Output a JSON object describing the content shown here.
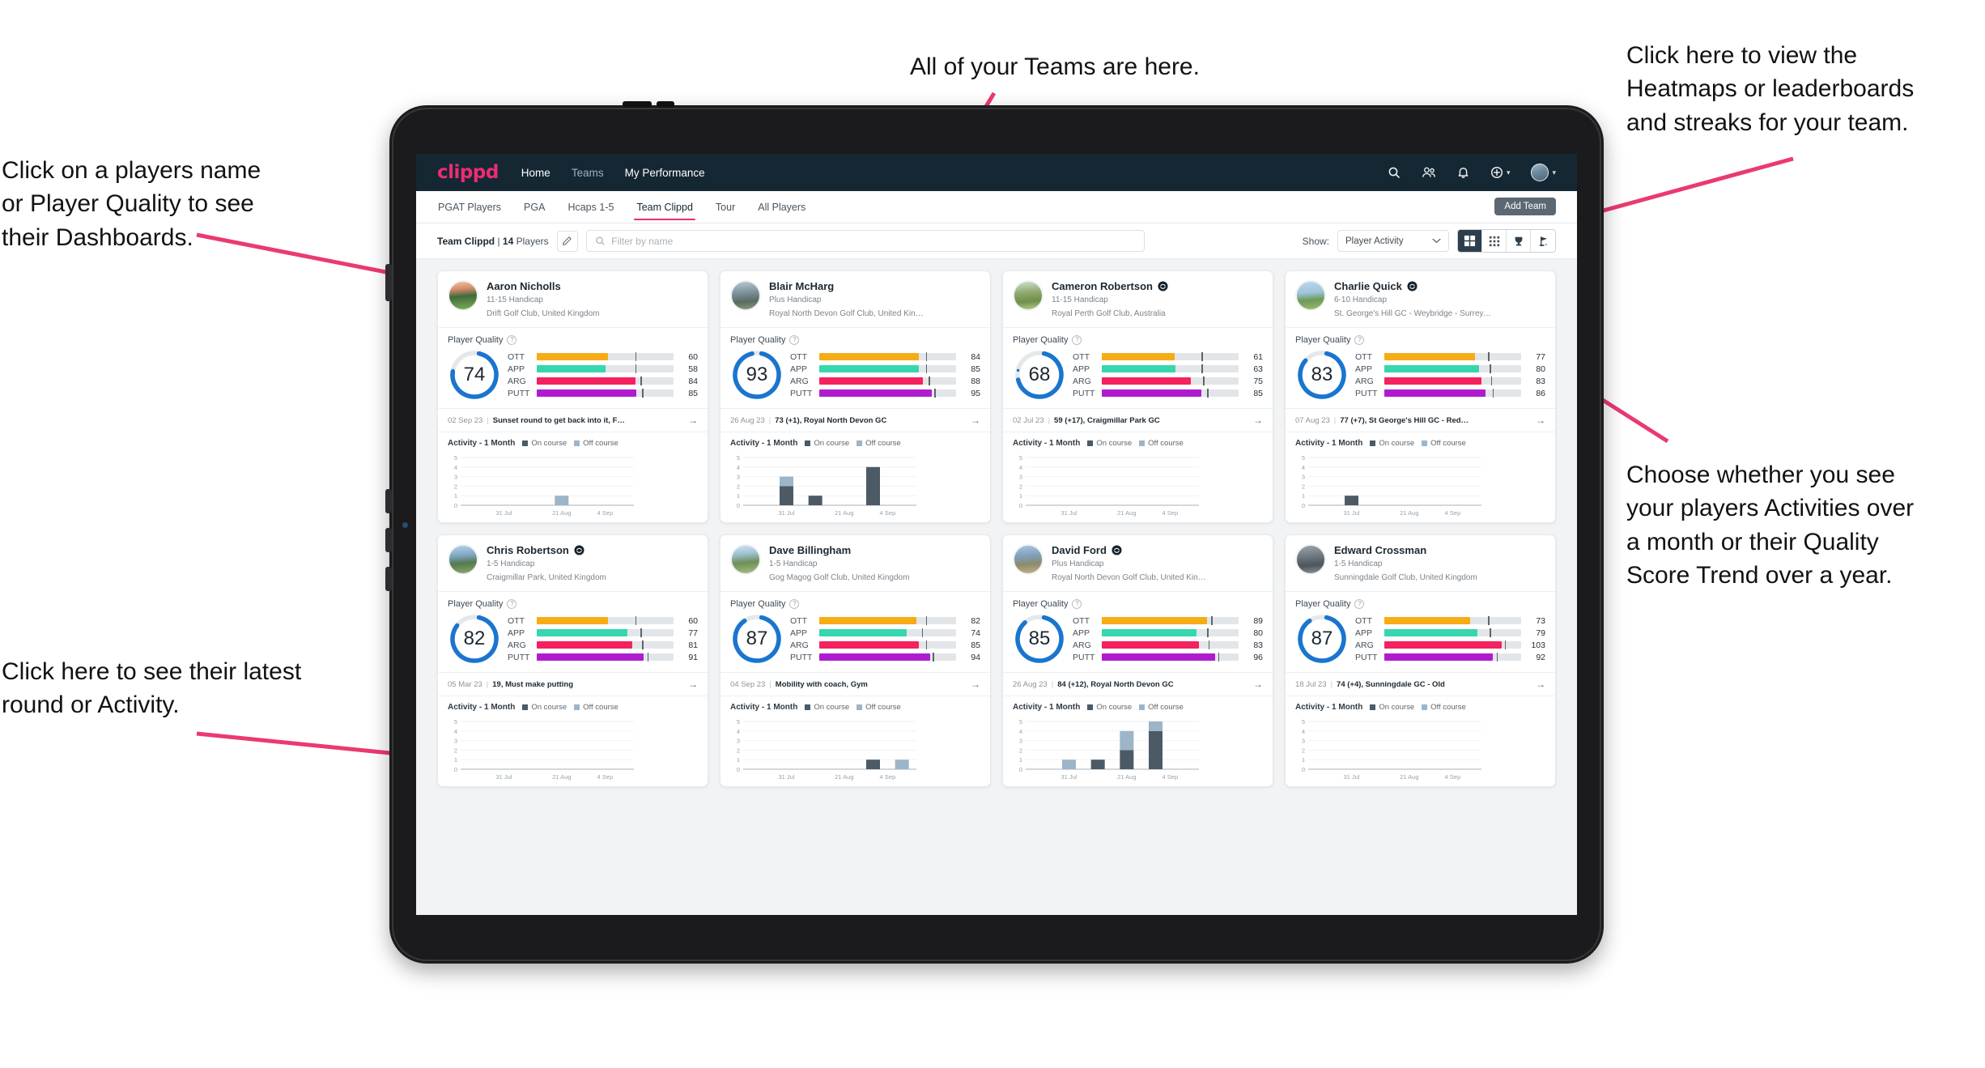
{
  "annotations": {
    "top": "All of your Teams are here.",
    "left_top": "Click on a players name\nor Player Quality to see\ntheir Dashboards.",
    "left_bottom": "Click here to see their latest\nround or Activity.",
    "right_top": "Click here to view the\nHeatmaps or leaderboards\nand streaks for your team.",
    "right_bottom": "Choose whether you see\nyour players Activities over\na month or their Quality\nScore Trend over a year.",
    "arrow_color": "#ea3a70"
  },
  "app": {
    "brand": "clippd",
    "nav": [
      {
        "label": "Home",
        "active": true
      },
      {
        "label": "Teams",
        "active": false
      },
      {
        "label": "My Performance",
        "active": false
      }
    ],
    "nav_icons": [
      {
        "name": "search-icon"
      },
      {
        "name": "people-icon"
      },
      {
        "name": "bell-icon"
      },
      {
        "name": "plus-circle-icon"
      },
      {
        "name": "avatar"
      }
    ],
    "tabs": [
      {
        "label": "PGAT Players",
        "active": false
      },
      {
        "label": "PGA",
        "active": false
      },
      {
        "label": "Hcaps 1-5",
        "active": false
      },
      {
        "label": "Team Clippd",
        "active": true
      },
      {
        "label": "Tour",
        "active": false
      },
      {
        "label": "All Players",
        "active": false
      }
    ],
    "add_team_label": "Add Team",
    "filter": {
      "team_name": "Team Clippd",
      "team_separator": " | ",
      "player_count": "14",
      "players_word": " Players",
      "edit_icon": "pencil-icon",
      "search_placeholder": "Filter by name",
      "search_value": "",
      "show_label": "Show:",
      "show_value": "Player Activity",
      "view_modes": [
        {
          "name": "grid-large-view",
          "active": true
        },
        {
          "name": "grid-small-view",
          "active": false
        },
        {
          "name": "trophy-leaderboard-view",
          "active": false
        },
        {
          "name": "flag-heatmap-view",
          "active": false
        }
      ]
    },
    "card_labels": {
      "player_quality": "Player Quality",
      "activity": "Activity - 1 Month",
      "legend_on": "On course",
      "legend_off": "Off course"
    },
    "metric_colors": {
      "OTT": "#f6ac14",
      "APP": "#36d6ae",
      "ARG": "#f4225f",
      "PUTT": "#af1ccf",
      "ring": "#1a75cf",
      "track": "#e3e6e9"
    },
    "chart_axis": {
      "y_ticks": [
        "5",
        "4",
        "3",
        "2",
        "1",
        "0"
      ],
      "x_ticks": [
        "31 Jul",
        "21 Aug",
        "4 Sep"
      ]
    }
  },
  "players": [
    {
      "name": "Aaron Nicholls",
      "verified": false,
      "handicap": "11-15 Handicap",
      "club": "Drift Golf Club, United Kingdom",
      "quality": "74",
      "ring_pct": 74,
      "metrics": [
        {
          "label": "OTT",
          "value": "60",
          "fill": 52,
          "tick": 72
        },
        {
          "label": "APP",
          "value": "58",
          "fill": 50,
          "tick": 72
        },
        {
          "label": "ARG",
          "value": "84",
          "fill": 72,
          "tick": 76
        },
        {
          "label": "PUTT",
          "value": "85",
          "fill": 73,
          "tick": 77
        }
      ],
      "latest_date": "02 Sep 23",
      "latest_text": "Sunset round to get back into it, F…",
      "chart_data": {
        "type": "bar",
        "title": "Activity - 1 Month",
        "series": [
          {
            "name": "On course",
            "values": [
              0,
              0,
              0,
              0,
              0,
              0
            ]
          },
          {
            "name": "Off course",
            "values": [
              0,
              0,
              0,
              1,
              0,
              0
            ]
          }
        ],
        "ylim": [
          0,
          5
        ]
      }
    },
    {
      "name": "Blair McHarg",
      "verified": false,
      "handicap": "Plus Handicap",
      "club": "Royal North Devon Golf Club, United Kin…",
      "quality": "93",
      "ring_pct": 93,
      "metrics": [
        {
          "label": "OTT",
          "value": "84",
          "fill": 73,
          "tick": 78
        },
        {
          "label": "APP",
          "value": "85",
          "fill": 73,
          "tick": 78
        },
        {
          "label": "ARG",
          "value": "88",
          "fill": 76,
          "tick": 80
        },
        {
          "label": "PUTT",
          "value": "95",
          "fill": 82,
          "tick": 84
        }
      ],
      "latest_date": "26 Aug 23",
      "latest_text": "73 (+1), Royal North Devon GC",
      "chart_data": {
        "type": "bar",
        "title": "Activity - 1 Month",
        "series": [
          {
            "name": "On course",
            "values": [
              0,
              2,
              1,
              0,
              4,
              0
            ]
          },
          {
            "name": "Off course",
            "values": [
              0,
              1,
              0,
              0,
              0,
              0
            ]
          }
        ],
        "ylim": [
          0,
          5
        ]
      }
    },
    {
      "name": "Cameron Robertson",
      "verified": true,
      "handicap": "11-15 Handicap",
      "club": "Royal Perth Golf Club, Australia",
      "quality": "68",
      "ring_pct": 68,
      "metrics": [
        {
          "label": "OTT",
          "value": "61",
          "fill": 53,
          "tick": 73
        },
        {
          "label": "APP",
          "value": "63",
          "fill": 54,
          "tick": 73
        },
        {
          "label": "ARG",
          "value": "75",
          "fill": 65,
          "tick": 74
        },
        {
          "label": "PUTT",
          "value": "85",
          "fill": 73,
          "tick": 77
        }
      ],
      "latest_date": "02 Jul 23",
      "latest_text": "59 (+17), Craigmillar Park GC",
      "chart_data": {
        "type": "bar",
        "title": "Activity - 1 Month",
        "series": [
          {
            "name": "On course",
            "values": [
              0,
              0,
              0,
              0,
              0,
              0
            ]
          },
          {
            "name": "Off course",
            "values": [
              0,
              0,
              0,
              0,
              0,
              0
            ]
          }
        ],
        "ylim": [
          0,
          5
        ]
      }
    },
    {
      "name": "Charlie Quick",
      "verified": true,
      "handicap": "6-10 Handicap",
      "club": "St. George's Hill GC - Weybridge - Surrey, …",
      "quality": "83",
      "ring_pct": 83,
      "metrics": [
        {
          "label": "OTT",
          "value": "77",
          "fill": 66,
          "tick": 76
        },
        {
          "label": "APP",
          "value": "80",
          "fill": 69,
          "tick": 77
        },
        {
          "label": "ARG",
          "value": "83",
          "fill": 71,
          "tick": 78
        },
        {
          "label": "PUTT",
          "value": "86",
          "fill": 74,
          "tick": 79
        }
      ],
      "latest_date": "07 Aug 23",
      "latest_text": "77 (+7), St George's Hill GC - Red…",
      "chart_data": {
        "type": "bar",
        "title": "Activity - 1 Month",
        "series": [
          {
            "name": "On course",
            "values": [
              0,
              1,
              0,
              0,
              0,
              0
            ]
          },
          {
            "name": "Off course",
            "values": [
              0,
              0,
              0,
              0,
              0,
              0
            ]
          }
        ],
        "ylim": [
          0,
          5
        ]
      }
    },
    {
      "name": "Chris Robertson",
      "verified": true,
      "handicap": "1-5 Handicap",
      "club": "Craigmillar Park, United Kingdom",
      "quality": "82",
      "ring_pct": 82,
      "metrics": [
        {
          "label": "OTT",
          "value": "60",
          "fill": 52,
          "tick": 72
        },
        {
          "label": "APP",
          "value": "77",
          "fill": 66,
          "tick": 76
        },
        {
          "label": "ARG",
          "value": "81",
          "fill": 70,
          "tick": 77
        },
        {
          "label": "PUTT",
          "value": "91",
          "fill": 78,
          "tick": 81
        }
      ],
      "latest_date": "05 Mar 23",
      "latest_text": "19, Must make putting",
      "chart_data": {
        "type": "bar",
        "title": "Activity - 1 Month",
        "series": [
          {
            "name": "On course",
            "values": [
              0,
              0,
              0,
              0,
              0,
              0
            ]
          },
          {
            "name": "Off course",
            "values": [
              0,
              0,
              0,
              0,
              0,
              0
            ]
          }
        ],
        "ylim": [
          0,
          5
        ]
      }
    },
    {
      "name": "Dave Billingham",
      "verified": false,
      "handicap": "1-5 Handicap",
      "club": "Gog Magog Golf Club, United Kingdom",
      "quality": "87",
      "ring_pct": 87,
      "metrics": [
        {
          "label": "OTT",
          "value": "82",
          "fill": 71,
          "tick": 78
        },
        {
          "label": "APP",
          "value": "74",
          "fill": 64,
          "tick": 75
        },
        {
          "label": "ARG",
          "value": "85",
          "fill": 73,
          "tick": 78
        },
        {
          "label": "PUTT",
          "value": "94",
          "fill": 81,
          "tick": 83
        }
      ],
      "latest_date": "04 Sep 23",
      "latest_text": "Mobility with coach, Gym",
      "chart_data": {
        "type": "bar",
        "title": "Activity - 1 Month",
        "series": [
          {
            "name": "On course",
            "values": [
              0,
              0,
              0,
              0,
              1,
              0
            ]
          },
          {
            "name": "Off course",
            "values": [
              0,
              0,
              0,
              0,
              0,
              1
            ]
          }
        ],
        "ylim": [
          0,
          5
        ]
      }
    },
    {
      "name": "David Ford",
      "verified": true,
      "handicap": "Plus Handicap",
      "club": "Royal North Devon Golf Club, United Kin…",
      "quality": "85",
      "ring_pct": 85,
      "metrics": [
        {
          "label": "OTT",
          "value": "89",
          "fill": 77,
          "tick": 80
        },
        {
          "label": "APP",
          "value": "80",
          "fill": 69,
          "tick": 77
        },
        {
          "label": "ARG",
          "value": "83",
          "fill": 71,
          "tick": 78
        },
        {
          "label": "PUTT",
          "value": "96",
          "fill": 83,
          "tick": 85
        }
      ],
      "latest_date": "26 Aug 23",
      "latest_text": "84 (+12), Royal North Devon GC",
      "chart_data": {
        "type": "bar",
        "title": "Activity - 1 Month",
        "series": [
          {
            "name": "On course",
            "values": [
              0,
              0,
              1,
              2,
              4,
              0
            ]
          },
          {
            "name": "Off course",
            "values": [
              0,
              1,
              0,
              2,
              1,
              0
            ]
          }
        ],
        "ylim": [
          0,
          5
        ]
      }
    },
    {
      "name": "Edward Crossman",
      "verified": false,
      "handicap": "1-5 Handicap",
      "club": "Sunningdale Golf Club, United Kingdom",
      "quality": "87",
      "ring_pct": 87,
      "metrics": [
        {
          "label": "OTT",
          "value": "73",
          "fill": 63,
          "tick": 76
        },
        {
          "label": "APP",
          "value": "79",
          "fill": 68,
          "tick": 77
        },
        {
          "label": "ARG",
          "value": "103",
          "fill": 86,
          "tick": 88
        },
        {
          "label": "PUTT",
          "value": "92",
          "fill": 79,
          "tick": 82
        }
      ],
      "latest_date": "18 Jul 23",
      "latest_text": "74 (+4), Sunningdale GC - Old",
      "chart_data": {
        "type": "bar",
        "title": "Activity - 1 Month",
        "series": [
          {
            "name": "On course",
            "values": [
              0,
              0,
              0,
              0,
              0,
              0
            ]
          },
          {
            "name": "Off course",
            "values": [
              0,
              0,
              0,
              0,
              0,
              0
            ]
          }
        ],
        "ylim": [
          0,
          5
        ]
      }
    }
  ]
}
